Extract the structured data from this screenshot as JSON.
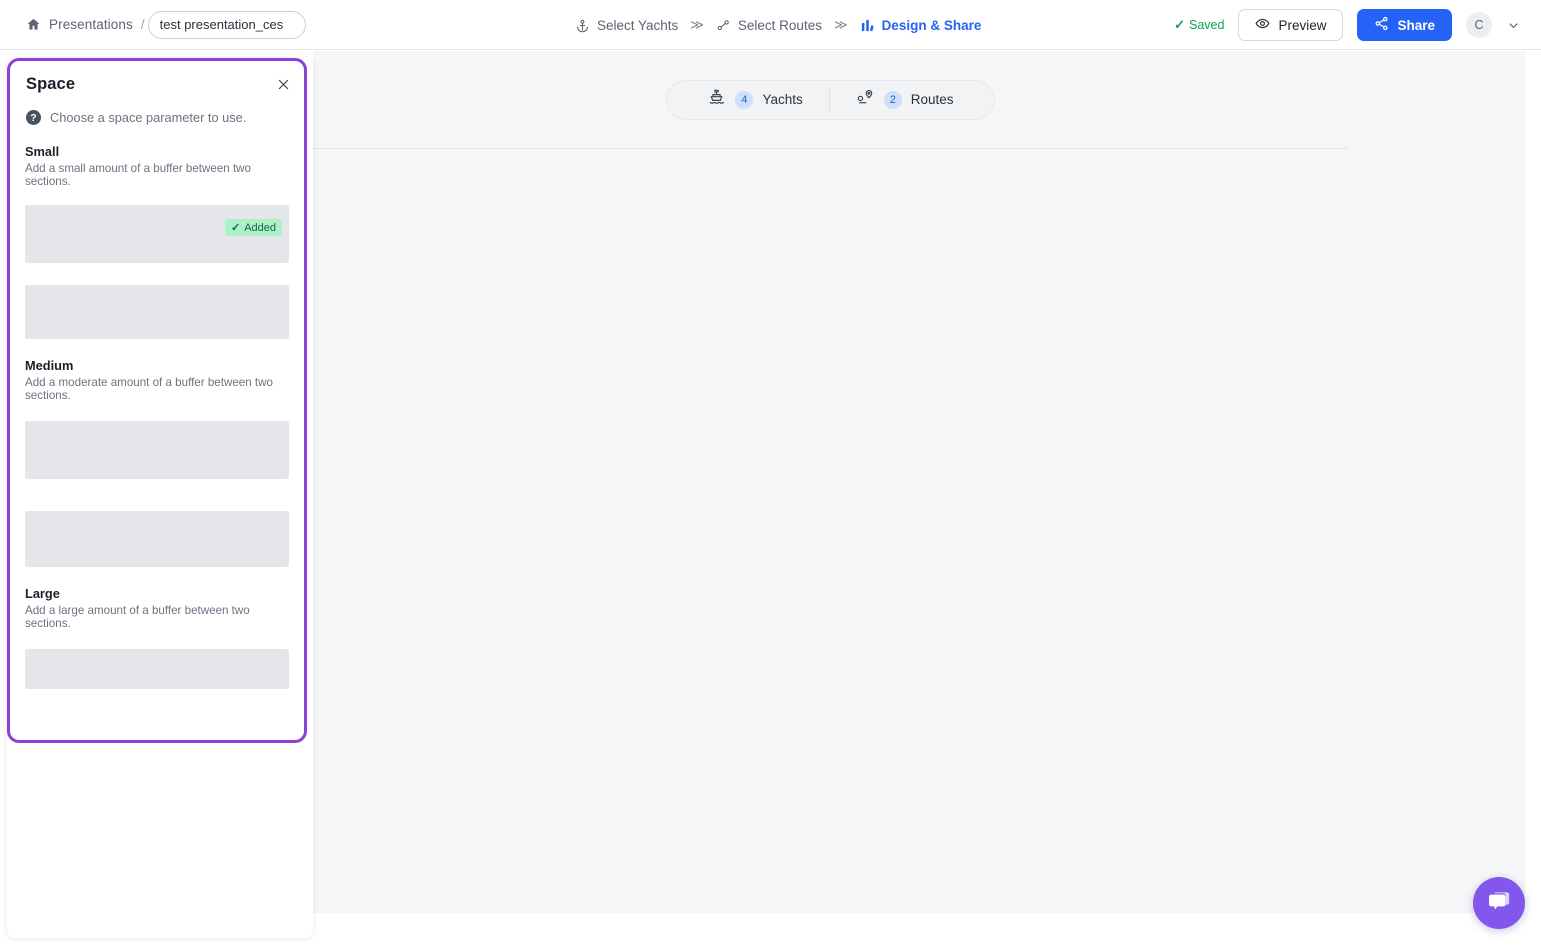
{
  "header": {
    "home_icon": "home-icon",
    "breadcrumb_link": "Presentations",
    "breadcrumb_separator": "/",
    "title_value": "test presentation_ces",
    "title_placeholder": "Presentation name",
    "steps": [
      {
        "label": "Select Yachts",
        "icon": "anchor-icon",
        "active": false
      },
      {
        "label": "Select Routes",
        "icon": "route-icon",
        "active": false
      },
      {
        "label": "Design & Share",
        "icon": "chart-icon",
        "active": true
      }
    ],
    "step_separator": "≫",
    "saved_check": "✓",
    "saved_label": "Saved",
    "preview_label": "Preview",
    "share_label": "Share",
    "avatar_initial": "C",
    "accent_blue": "#2563f6",
    "saved_green": "#10a050"
  },
  "main": {
    "toggle": [
      {
        "icon": "yacht-icon",
        "count": "4",
        "label": "Yachts"
      },
      {
        "icon": "route-pin-icon",
        "count": "2",
        "label": "Routes"
      }
    ]
  },
  "popover": {
    "title": "Space",
    "close_icon": "close-icon",
    "hint_icon": "question-mark-icon",
    "hint": "Choose a space parameter to use.",
    "border_color": "#8b40d6",
    "sections": [
      {
        "title": "Small",
        "desc": "Add a small amount of a buffer between two sections.",
        "badge_check": "✓",
        "badge_label": "Added"
      },
      {
        "title": "Medium",
        "desc": "Add a moderate amount of a buffer between two sections."
      },
      {
        "title": "Large",
        "desc": "Add a large amount of a buffer between two sections."
      }
    ]
  },
  "chat": {
    "icon": "chat-bubble-icon",
    "color": "#8457ec"
  }
}
